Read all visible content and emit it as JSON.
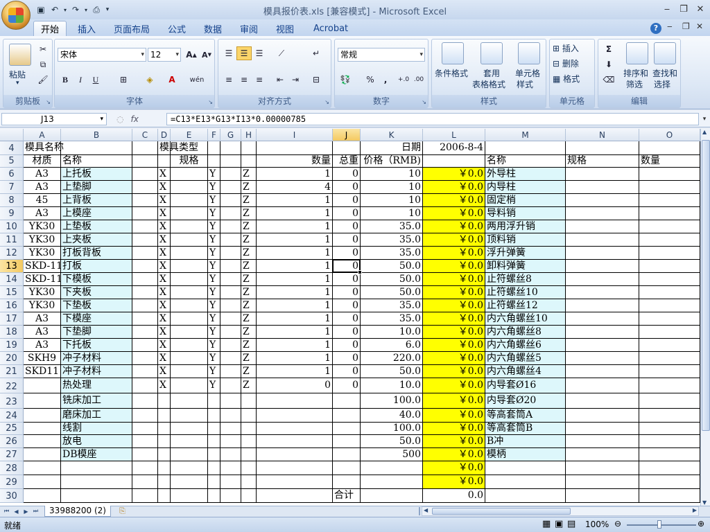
{
  "app": {
    "title": "模具报价表.xls  [兼容模式] - Microsoft Excel",
    "qat": [
      "save-icon",
      "undo-icon",
      "redo-icon",
      "print-preview-icon",
      "customize-icon"
    ]
  },
  "tabs": [
    "开始",
    "插入",
    "页面布局",
    "公式",
    "数据",
    "审阅",
    "视图",
    "Acrobat"
  ],
  "ribbon": {
    "clipboard": {
      "paste": "粘贴",
      "label": "剪贴板"
    },
    "font": {
      "name": "宋体",
      "size": "12",
      "label": "字体",
      "bold": "B",
      "italic": "I",
      "underline": "U",
      "wen": "wén"
    },
    "align": {
      "label": "对齐方式"
    },
    "number": {
      "format": "常规",
      "label": "数字",
      "percent": "%",
      "comma": ","
    },
    "styles": {
      "cond": "条件格式",
      "table1": "套用",
      "table2": "表格格式",
      "cell1": "单元格",
      "cell2": "样式",
      "label": "样式"
    },
    "cells": {
      "insert": "插入",
      "delete": "删除",
      "format": "格式",
      "label": "单元格"
    },
    "editing": {
      "sort1": "排序和",
      "sort2": "筛选",
      "find1": "查找和",
      "find2": "选择",
      "label": "编辑",
      "sigma": "Σ"
    }
  },
  "formula_bar": {
    "name_box": "J13",
    "fx": "fx",
    "formula": "=C13*E13*G13*I13*0.00000785"
  },
  "columns": [
    "A",
    "B",
    "C",
    "D",
    "E",
    "F",
    "G",
    "H",
    "I",
    "J",
    "K",
    "L",
    "M",
    "N",
    "O"
  ],
  "rows": [
    {
      "num": "4",
      "A": "模具名称",
      "D": "模具类型",
      "K": "日期",
      "L": "2006-8-4"
    },
    {
      "num": "5",
      "A": "材质",
      "B": "名称",
      "E": "规格",
      "I": "数量",
      "J": "总重",
      "K": "价格（RMB)",
      "M": "名称",
      "N": "规格",
      "O": "数量"
    },
    {
      "num": "6",
      "A": "A3",
      "B": "上托板",
      "D": "X",
      "F": "Y",
      "H": "Z",
      "I": "1",
      "J": "0",
      "K": "10",
      "L": "￥0.0",
      "M": "外导柱"
    },
    {
      "num": "7",
      "A": "A3",
      "B": "上垫脚",
      "D": "X",
      "F": "Y",
      "H": "Z",
      "I": "4",
      "J": "0",
      "K": "10",
      "L": "￥0.0",
      "M": "内导柱"
    },
    {
      "num": "8",
      "A": "45",
      "B": "上背板",
      "D": "X",
      "F": "Y",
      "H": "Z",
      "I": "1",
      "J": "0",
      "K": "10",
      "L": "￥0.0",
      "M": "固定梢"
    },
    {
      "num": "9",
      "A": "A3",
      "B": "上模座",
      "D": "X",
      "F": "Y",
      "H": "Z",
      "I": "1",
      "J": "0",
      "K": "10",
      "L": "￥0.0",
      "M": "导料销"
    },
    {
      "num": "10",
      "A": "YK30",
      "B": "上垫板",
      "D": "X",
      "F": "Y",
      "H": "Z",
      "I": "1",
      "J": "0",
      "K": "35.0",
      "L": "￥0.0",
      "M": "两用浮升销"
    },
    {
      "num": "11",
      "A": "YK30",
      "B": "上夹板",
      "D": "X",
      "F": "Y",
      "H": "Z",
      "I": "1",
      "J": "0",
      "K": "35.0",
      "L": "￥0.0",
      "M": "顶料销"
    },
    {
      "num": "12",
      "A": "YK30",
      "B": "打板背板",
      "D": "X",
      "F": "Y",
      "H": "Z",
      "I": "1",
      "J": "0",
      "K": "35.0",
      "L": "￥0.0",
      "M": "浮升弹簧"
    },
    {
      "num": "13",
      "A": "SKD-11",
      "B": "打板",
      "D": "X",
      "F": "Y",
      "H": "Z",
      "I": "1",
      "J": "0",
      "K": "50.0",
      "L": "￥0.0",
      "M": "卸料弹簧"
    },
    {
      "num": "14",
      "A": "SKD-11",
      "B": "下模板",
      "D": "X",
      "F": "Y",
      "H": "Z",
      "I": "1",
      "J": "0",
      "K": "50.0",
      "L": "￥0.0",
      "M": "止符螺丝8"
    },
    {
      "num": "15",
      "A": "YK30",
      "B": "下夹板",
      "D": "X",
      "F": "Y",
      "H": "Z",
      "I": "1",
      "J": "0",
      "K": "50.0",
      "L": "￥0.0",
      "M": "止符螺丝10"
    },
    {
      "num": "16",
      "A": "YK30",
      "B": "下垫板",
      "D": "X",
      "F": "Y",
      "H": "Z",
      "I": "1",
      "J": "0",
      "K": "35.0",
      "L": "￥0.0",
      "M": "止符螺丝12"
    },
    {
      "num": "17",
      "A": "A3",
      "B": "下模座",
      "D": "X",
      "F": "Y",
      "H": "Z",
      "I": "1",
      "J": "0",
      "K": "35.0",
      "L": "￥0.0",
      "M": "内六角螺丝10"
    },
    {
      "num": "18",
      "A": "A3",
      "B": "下垫脚",
      "D": "X",
      "F": "Y",
      "H": "Z",
      "I": "1",
      "J": "0",
      "K": "10.0",
      "L": "￥0.0",
      "M": "内六角螺丝8"
    },
    {
      "num": "19",
      "A": "A3",
      "B": "下托板",
      "D": "X",
      "F": "Y",
      "H": "Z",
      "I": "1",
      "J": "0",
      "K": "6.0",
      "L": "￥0.0",
      "M": "内六角螺丝6"
    },
    {
      "num": "20",
      "A": "SKH9",
      "B": "冲子材料",
      "D": "X",
      "F": "Y",
      "H": "Z",
      "I": "1",
      "J": "0",
      "K": "220.0",
      "L": "￥0.0",
      "M": "内六角螺丝5"
    },
    {
      "num": "21",
      "A": "SKD11",
      "B": "冲子材料",
      "D": "X",
      "F": "Y",
      "H": "Z",
      "I": "1",
      "J": "0",
      "K": "50.0",
      "L": "￥0.0",
      "M": "内六角螺丝4"
    },
    {
      "num": "22",
      "B": "热处理",
      "D": "X",
      "F": "Y",
      "H": "Z",
      "I": "0",
      "J": "0",
      "K": "10.0",
      "L": "￥0.0",
      "M": "内导套Ø16"
    },
    {
      "num": "23",
      "B": "铣床加工",
      "K": "100.0",
      "L": "￥0.0",
      "M": "内导套Ø20"
    },
    {
      "num": "24",
      "B": "磨床加工",
      "K": "40.0",
      "L": "￥0.0",
      "M": "等高套筒A"
    },
    {
      "num": "25",
      "B": "线割",
      "K": "100.0",
      "L": "￥0.0",
      "M": "等高套筒B"
    },
    {
      "num": "26",
      "B": "放电",
      "K": "50.0",
      "L": "￥0.0",
      "M": "B冲"
    },
    {
      "num": "27",
      "B": "DB模座",
      "K": "500",
      "L": "￥0.0",
      "M": "模柄"
    },
    {
      "num": "28",
      "L": "￥0.0"
    },
    {
      "num": "29",
      "L": "￥0.0"
    },
    {
      "num": "30",
      "J": "合计",
      "L": "0.0"
    }
  ],
  "sheet_tab": "33988200  (2)",
  "status": {
    "ready": "就绪",
    "zoom": "100%"
  },
  "colors": {
    "cyan": "#ddf7fb",
    "yellow": "#ffff00",
    "ribbon": "#dce7f5"
  }
}
